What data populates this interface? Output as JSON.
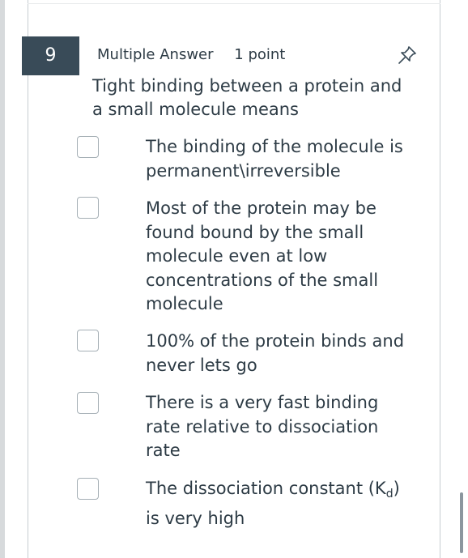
{
  "question": {
    "number": "9",
    "type": "Multiple Answer",
    "points": "1 point",
    "prompt": "Tight binding between a protein and a small molecule means"
  },
  "answers": [
    {
      "text": "The binding of the molecule is permanent\\irreversible"
    },
    {
      "text": "Most of the protein may be found bound by the small molecule even at low concentrations of the small molecule"
    },
    {
      "text": "100% of the protein binds and never lets go"
    },
    {
      "text": "There is a very fast binding rate relative to dissociation rate"
    },
    {
      "text_before": "The dissociation constant (K",
      "subscript": "d",
      "text_after": ") is very high"
    }
  ],
  "icons": {
    "pin": "pin-icon"
  },
  "colors": {
    "number_badge_bg": "#394b58",
    "text": "#2d3b45",
    "checkbox_border": "#a5afb5"
  }
}
